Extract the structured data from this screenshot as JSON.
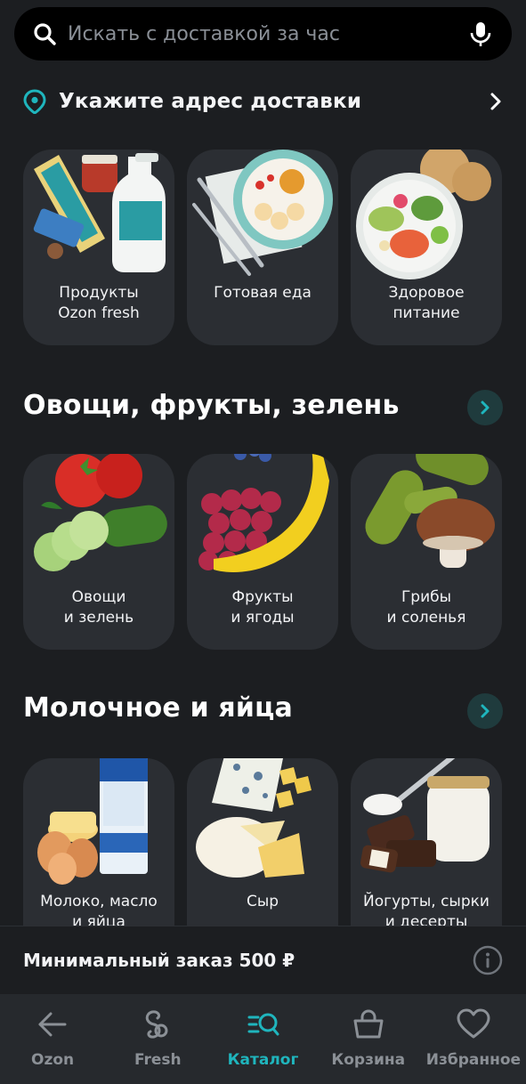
{
  "search": {
    "placeholder": "Искать с доставкой за час"
  },
  "address": {
    "label": "Укажите адрес доставки"
  },
  "top_tiles": [
    {
      "label": "Продукты\nOzon fresh"
    },
    {
      "label": "Готовая еда"
    },
    {
      "label": "Здоровое\nпитание"
    }
  ],
  "sections": [
    {
      "title": "Овощи, фрукты, зелень",
      "tiles": [
        {
          "label": "Овощи\nи зелень"
        },
        {
          "label": "Фрукты\nи ягоды"
        },
        {
          "label": "Грибы\nи соленья"
        }
      ]
    },
    {
      "title": "Молочное и яйца",
      "tiles": [
        {
          "label": "Молоко, масло\nи яйца"
        },
        {
          "label": "Сыр"
        },
        {
          "label": "Йогурты, сырки\nи десерты"
        }
      ]
    }
  ],
  "min_order": {
    "label": "Минимальный заказ 500 ₽"
  },
  "tabs": [
    {
      "label": "Ozon",
      "icon": "arrow-left-icon",
      "active": false
    },
    {
      "label": "Fresh",
      "icon": "fresh-icon",
      "active": false
    },
    {
      "label": "Каталог",
      "icon": "catalog-search-icon",
      "active": true
    },
    {
      "label": "Корзина",
      "icon": "basket-icon",
      "active": false
    },
    {
      "label": "Избранное",
      "icon": "heart-icon",
      "active": false
    }
  ],
  "colors": {
    "accent": "#1fb5bd",
    "background": "#1c1e21",
    "tile": "#2b2e33",
    "tabbar": "#26292d"
  }
}
